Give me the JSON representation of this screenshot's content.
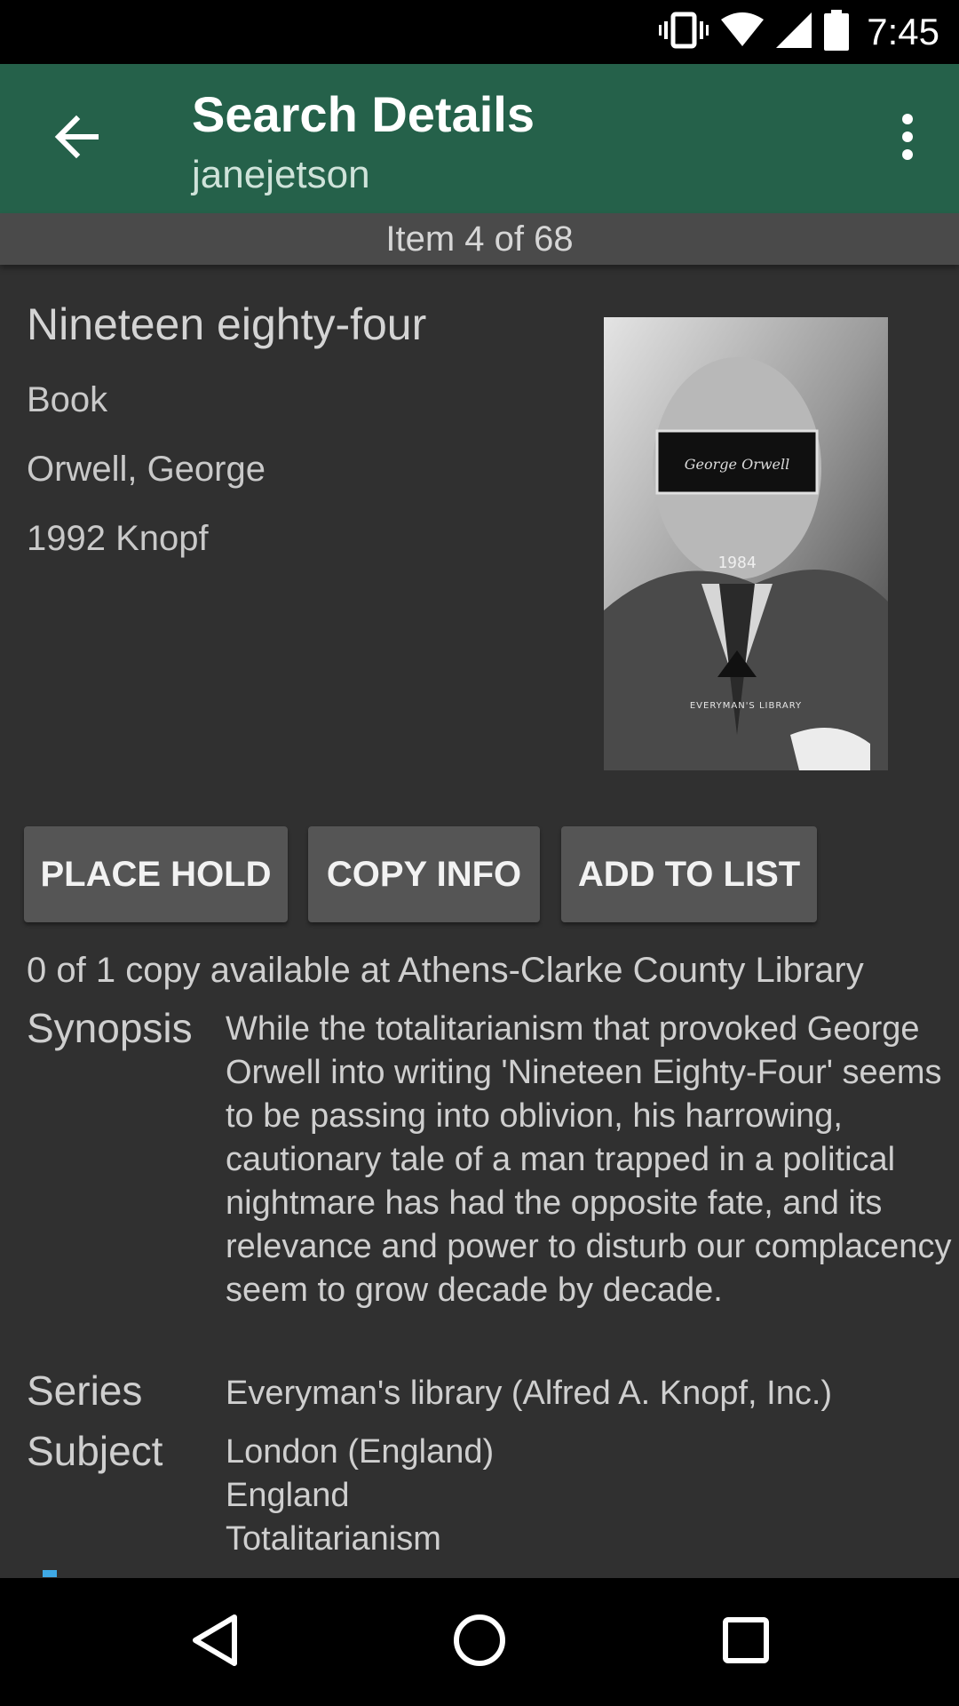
{
  "status_bar": {
    "time": "7:45",
    "icons": [
      "vibrate-icon",
      "wifi-icon",
      "signal-icon",
      "battery-icon"
    ]
  },
  "app_bar": {
    "title": "Search Details",
    "subtitle": "janejetson",
    "back_icon": "arrow-back-icon",
    "overflow_icon": "more-vert-icon"
  },
  "counter": "Item 4 of 68",
  "item": {
    "title": "Nineteen eighty-four",
    "format": "Book",
    "author": "Orwell, George",
    "publication": "1992 Knopf"
  },
  "cover": {
    "author_label": "George Orwell",
    "number": "1984",
    "imprint": "EVERYMAN'S LIBRARY"
  },
  "actions": {
    "place_hold": "PLACE HOLD",
    "copy_info": "COPY INFO",
    "add_to_list": "ADD TO LIST"
  },
  "availability": "0 of 1 copy available at Athens-Clarke County Library",
  "details": {
    "synopsis_label": "Synopsis",
    "synopsis": "While the totalitarianism that provoked George Orwell into writing 'Nineteen Eighty-Four' seems to be passing into oblivion, his harrowing, cautionary tale of a man trapped in a political nightmare has had the opposite fate, and its relevance and power to disturb our complacency seem to grow decade by decade.",
    "series_label": "Series",
    "series": "Everyman's library (Alfred A. Knopf, Inc.)",
    "subject_label": "Subject",
    "subjects": [
      "London (England)",
      "England",
      "Totalitarianism"
    ]
  },
  "colors": {
    "app_bar": "#25614a",
    "background": "#303030",
    "button": "#555555",
    "accent": "#3fa9e6"
  },
  "nav_bar": {
    "icons": [
      "nav-back-icon",
      "nav-home-icon",
      "nav-recents-icon"
    ]
  }
}
